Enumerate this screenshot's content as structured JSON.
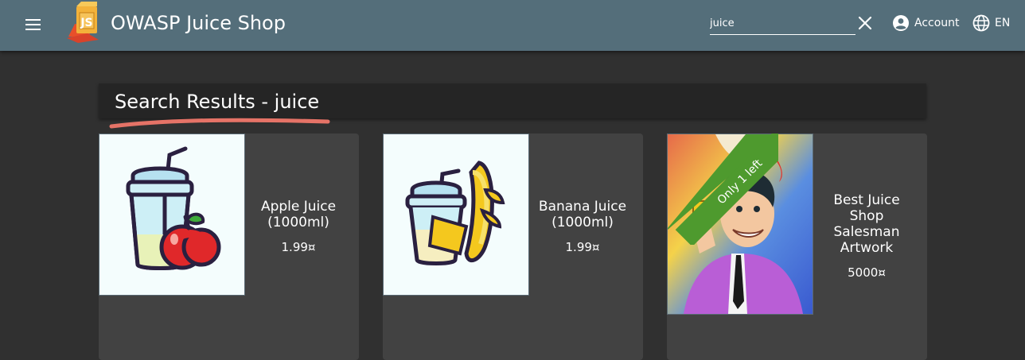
{
  "header": {
    "title": "OWASP Juice Shop",
    "search_value": "juice",
    "account_label": "Account",
    "language_label": "EN"
  },
  "results": {
    "title": "Search Results - juice",
    "accent_color": "#e57367"
  },
  "products": [
    {
      "name": "Apple Juice (1000ml)",
      "price": "1.99¤",
      "image": "apple-juice-image"
    },
    {
      "name": "Banana Juice (1000ml)",
      "price": "1.99¤",
      "image": "banana-juice-image"
    },
    {
      "name": "Best Juice Shop Salesman Artwork",
      "price": "5000¤",
      "image": "salesman-artwork-image",
      "ribbon": "Only 1 left"
    }
  ],
  "colors": {
    "toolbar": "#546e7a",
    "background": "#303030",
    "card": "#424242",
    "ribbon": "#4e9a2e"
  }
}
